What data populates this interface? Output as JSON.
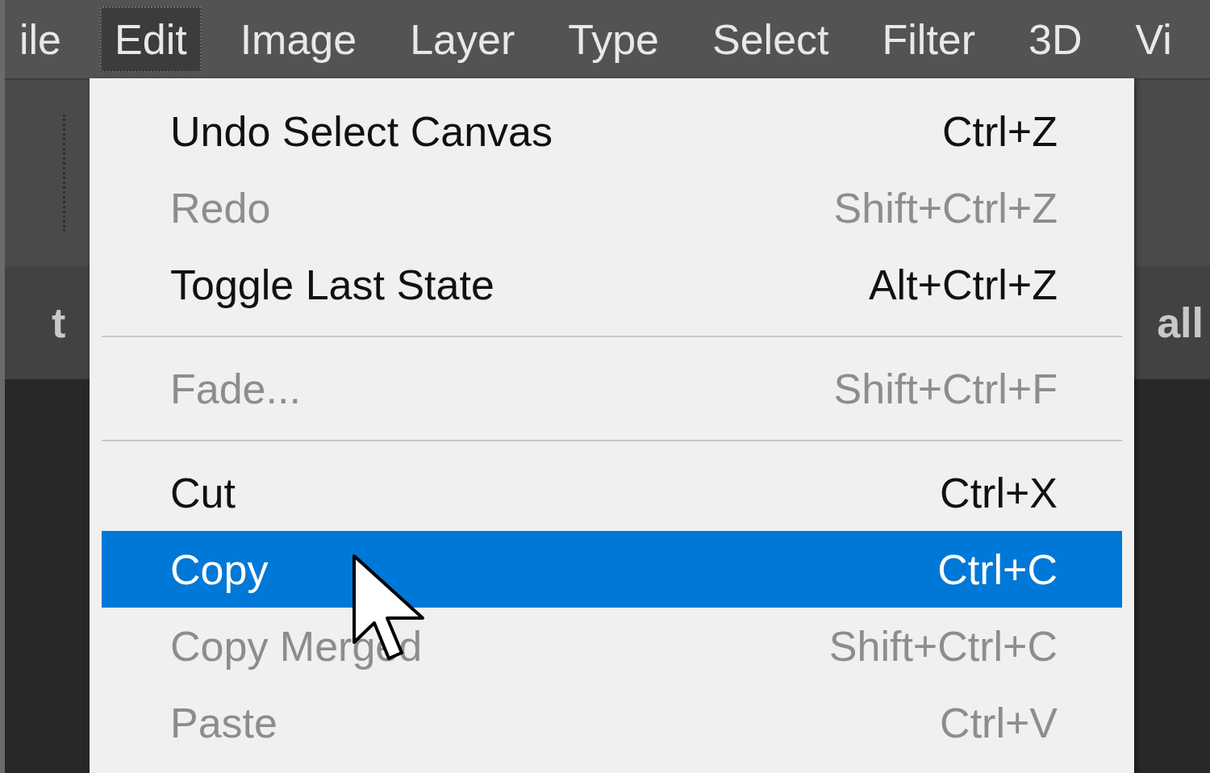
{
  "menu_bar": [
    {
      "label": "ile",
      "selected": false
    },
    {
      "label": "Edit",
      "selected": true
    },
    {
      "label": "Image",
      "selected": false
    },
    {
      "label": "Layer",
      "selected": false
    },
    {
      "label": "Type",
      "selected": false
    },
    {
      "label": "Select",
      "selected": false
    },
    {
      "label": "Filter",
      "selected": false
    },
    {
      "label": "3D",
      "selected": false
    },
    {
      "label": "Vi",
      "selected": false
    }
  ],
  "document_tab": {
    "left_text": "t",
    "right_text": "all"
  },
  "edit_menu": [
    {
      "kind": "command",
      "label": "Undo Select Canvas",
      "shortcut": "Ctrl+Z",
      "disabled": false,
      "selected": false
    },
    {
      "kind": "command",
      "label": "Redo",
      "shortcut": "Shift+Ctrl+Z",
      "disabled": true,
      "selected": false
    },
    {
      "kind": "command",
      "label": "Toggle Last State",
      "shortcut": "Alt+Ctrl+Z",
      "disabled": false,
      "selected": false
    },
    {
      "kind": "separator"
    },
    {
      "kind": "command",
      "label": "Fade...",
      "shortcut": "Shift+Ctrl+F",
      "disabled": true,
      "selected": false
    },
    {
      "kind": "separator"
    },
    {
      "kind": "command",
      "label": "Cut",
      "shortcut": "Ctrl+X",
      "disabled": false,
      "selected": false
    },
    {
      "kind": "command",
      "label": "Copy",
      "shortcut": "Ctrl+C",
      "disabled": false,
      "selected": true
    },
    {
      "kind": "command",
      "label": "Copy Merged",
      "shortcut": "Shift+Ctrl+C",
      "disabled": true,
      "selected": false
    },
    {
      "kind": "command",
      "label": "Paste",
      "shortcut": "Ctrl+V",
      "disabled": true,
      "selected": false
    }
  ]
}
